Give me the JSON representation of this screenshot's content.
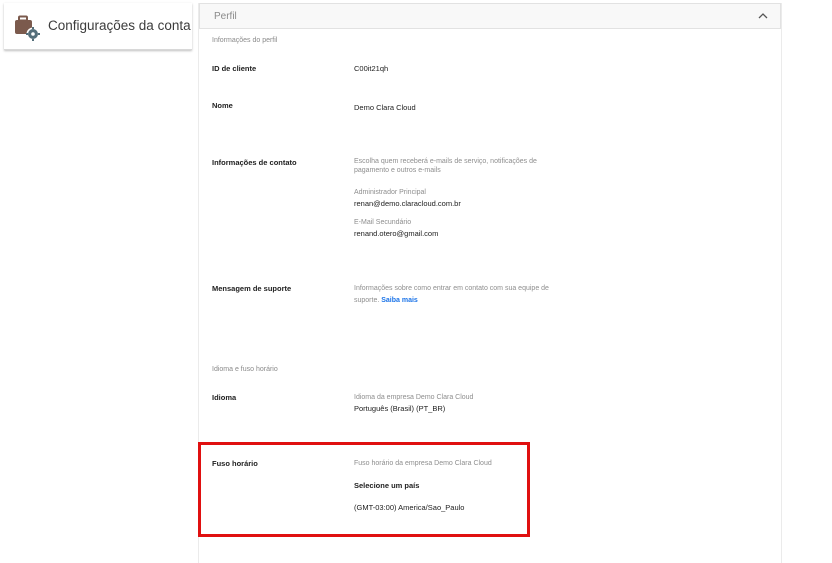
{
  "sidebar": {
    "title": "Configurações da conta",
    "icon": "briefcase-gear-icon"
  },
  "panel": {
    "title": "Perfil",
    "collapse_icon": "chevron-up-icon"
  },
  "profile": {
    "section_title": "Informações do perfil",
    "customer_id": {
      "label": "ID de cliente",
      "value": "C00it21qh"
    },
    "name": {
      "label": "Nome",
      "value": "Demo Clara Cloud"
    },
    "contact": {
      "label": "Informações de contato",
      "description_line1": "Escolha quem receberá e-mails de serviço, notificações de",
      "description_line2": "pagamento e outros e-mails",
      "primary_admin_label": "Administrador Principal",
      "primary_admin_email": "renan@demo.claracloud.com.br",
      "secondary_email_label": "E-Mail Secundário",
      "secondary_email": "renand.otero@gmail.com"
    },
    "support": {
      "label": "Mensagem de suporte",
      "description_line1": "Informações sobre como entrar em contato com sua equipe de",
      "description_line2_prefix": "suporte.",
      "learn_more": "Saiba mais"
    }
  },
  "locale": {
    "section_title": "Idioma e fuso horário",
    "language": {
      "label": "Idioma",
      "description": "Idioma da empresa Demo Clara Cloud",
      "value": "Português (Brasil) (PT_BR)"
    },
    "timezone": {
      "label": "Fuso horário",
      "description": "Fuso horário da empresa Demo Clara Cloud",
      "country_select": "Selecione um país",
      "zone_value": "(GMT-03:00) America/Sao_Paulo"
    }
  },
  "colors": {
    "highlight": "#e01010",
    "link": "#1a73e8"
  }
}
